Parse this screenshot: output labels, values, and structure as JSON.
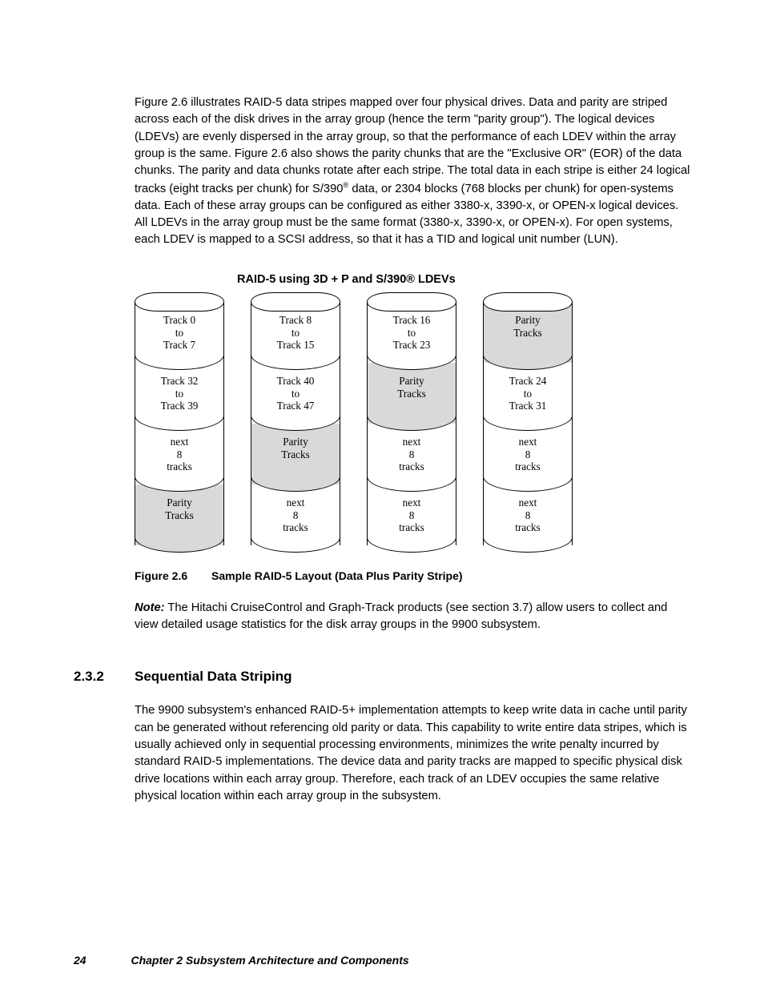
{
  "para1": "Figure 2.6 illustrates RAID-5 data stripes mapped over four physical drives. Data and parity are striped across each of the disk drives in the array group (hence the term \"parity group\"). The logical devices (LDEVs) are evenly dispersed in the array group, so that the performance of each LDEV within the array group is the same. Figure 2.6 also shows the parity chunks that are the \"Exclusive OR\" (EOR) of the data chunks. The parity and data chunks rotate after each stripe. The total data in each stripe is either 24 logical tracks (eight tracks per chunk) for S/390",
  "para1b": " data, or 2304 blocks (768 blocks per chunk) for open-systems data. Each of these array groups can be configured as either 3380-x, 3390-x, or OPEN-x logical devices. All LDEVs in the array group must be the same format (3380-x, 3390-x, or OPEN-x). For open systems, each LDEV is mapped to a SCSI address, so that it has a TID and logical unit number (LUN).",
  "figtitle": "RAID-5 using 3D + P and S/390® LDEVs",
  "capnum": "Figure 2.6",
  "captext": "Sample RAID-5 Layout (Data Plus Parity Stripe)",
  "notelabel": "Note:",
  "note": " The Hitachi CruiseControl and Graph-Track products (see section 3.7) allow users to collect and view detailed usage statistics for the disk array groups in the 9900 subsystem.",
  "secnum": "2.3.2",
  "sectitle": "Sequential Data Striping",
  "para2": "The 9900 subsystem's enhanced RAID-5+ implementation attempts to keep write data in cache until parity can be generated without referencing old parity or data. This capability to write entire data stripes, which is usually achieved only in sequential processing environments, minimizes the write penalty incurred by standard RAID-5 implementations. The device data and parity tracks are mapped to specific physical disk drive locations within each array group. Therefore, each track of an LDEV occupies the same relative physical location within each array group in the subsystem.",
  "pagenum": "24",
  "chapter": "Chapter 2    Subsystem Architecture and Components",
  "drive1": {
    "s1a": "Track 0",
    "s1b": "to",
    "s1c": "Track 7",
    "s2a": "Track 32",
    "s2b": "to",
    "s2c": "Track 39",
    "s3a": "next",
    "s3b": "8",
    "s3c": "tracks",
    "s4a": "Parity",
    "s4b": "Tracks",
    "s4c": ""
  },
  "drive2": {
    "s1a": "Track 8",
    "s1b": "to",
    "s1c": "Track 15",
    "s2a": "Track 40",
    "s2b": "to",
    "s2c": "Track 47",
    "s3a": "Parity",
    "s3b": "Tracks",
    "s3c": "",
    "s4a": "next",
    "s4b": "8",
    "s4c": "tracks"
  },
  "drive3": {
    "s1a": "Track 16",
    "s1b": "to",
    "s1c": "Track 23",
    "s2a": "Parity",
    "s2b": "Tracks",
    "s2c": "",
    "s3a": "next",
    "s3b": "8",
    "s3c": "tracks",
    "s4a": "next",
    "s4b": "8",
    "s4c": "tracks"
  },
  "drive4": {
    "s1a": "Parity",
    "s1b": "Tracks",
    "s1c": "",
    "s2a": "Track 24",
    "s2b": "to",
    "s2c": "Track 31",
    "s3a": "next",
    "s3b": "8",
    "s3c": "tracks",
    "s4a": "next",
    "s4b": "8",
    "s4c": "tracks"
  },
  "shade": {
    "d1": [
      "white",
      "white",
      "white",
      "grey"
    ],
    "d2": [
      "white",
      "white",
      "grey",
      "white"
    ],
    "d3": [
      "white",
      "grey",
      "white",
      "white"
    ],
    "d4": [
      "grey",
      "white",
      "white",
      "white"
    ]
  }
}
